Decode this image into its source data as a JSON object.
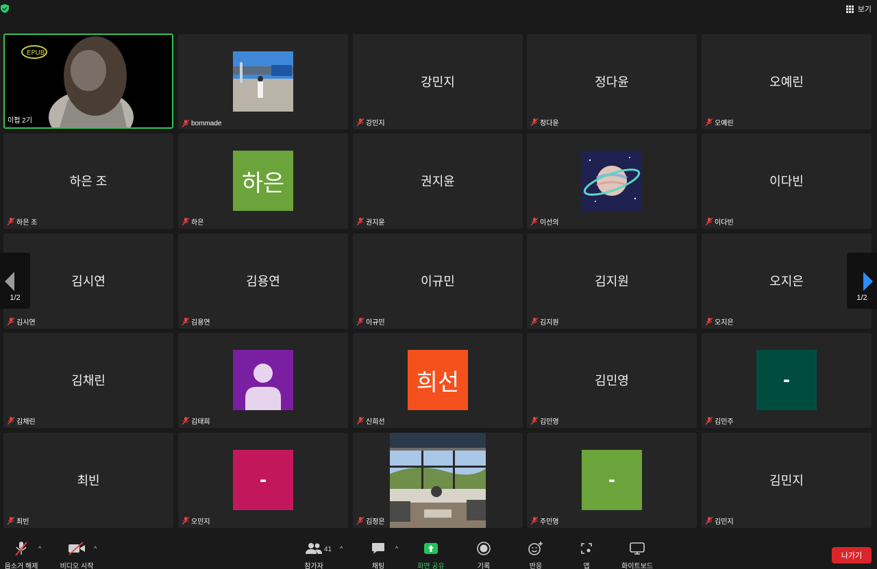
{
  "topbar": {
    "view_label": "보기"
  },
  "pager": {
    "left_page": "1/2",
    "right_page": "1/2"
  },
  "tiles": [
    {
      "footer": "이펍 2기",
      "center": "",
      "avatar": ""
    },
    {
      "footer": "bommade",
      "center": "",
      "avatar": ""
    },
    {
      "footer": "강민지",
      "center": "강민지",
      "avatar": ""
    },
    {
      "footer": "정다윤",
      "center": "정다윤",
      "avatar": ""
    },
    {
      "footer": "오예린",
      "center": "오예린",
      "avatar": ""
    },
    {
      "footer": "하은 조",
      "center": "하은 조",
      "avatar": ""
    },
    {
      "footer": "하은",
      "center": "",
      "avatar": "하은"
    },
    {
      "footer": "권지윤",
      "center": "권지윤",
      "avatar": ""
    },
    {
      "footer": "이선의",
      "center": "",
      "avatar": ""
    },
    {
      "footer": "이다빈",
      "center": "이다빈",
      "avatar": ""
    },
    {
      "footer": "김시연",
      "center": "김시연",
      "avatar": ""
    },
    {
      "footer": "김용연",
      "center": "김용연",
      "avatar": ""
    },
    {
      "footer": "이규민",
      "center": "이규민",
      "avatar": ""
    },
    {
      "footer": "김지원",
      "center": "김지원",
      "avatar": ""
    },
    {
      "footer": "오지은",
      "center": "오지은",
      "avatar": ""
    },
    {
      "footer": "김채린",
      "center": "김채린",
      "avatar": ""
    },
    {
      "footer": "김태희",
      "center": "",
      "avatar": ""
    },
    {
      "footer": "신희선",
      "center": "",
      "avatar": "희선"
    },
    {
      "footer": "김민영",
      "center": "김민영",
      "avatar": ""
    },
    {
      "footer": "김민주",
      "center": "",
      "avatar": "-"
    },
    {
      "footer": "최빈",
      "center": "최빈",
      "avatar": ""
    },
    {
      "footer": "오민지",
      "center": "",
      "avatar": "-"
    },
    {
      "footer": "김정은",
      "center": "",
      "avatar": ""
    },
    {
      "footer": "주민영",
      "center": "",
      "avatar": "-"
    },
    {
      "footer": "김민지",
      "center": "김민지",
      "avatar": ""
    }
  ],
  "colors": {
    "avatar_green": "#6aa43a",
    "avatar_orange": "#f4511e",
    "avatar_purple": "#7b1fa2",
    "avatar_teal": "#004d40",
    "avatar_magenta": "#c2185b",
    "active_border": "#32c45a",
    "leave_red": "#d9262b",
    "share_green": "#3ec66b"
  },
  "toolbar": {
    "unmute": "음소거 해제",
    "start_video": "비디오 시작",
    "participants": "참가자",
    "participants_count": "41",
    "chat": "채팅",
    "share_screen": "화면 공유",
    "record": "기록",
    "reactions": "반응",
    "apps": "앱",
    "whiteboard": "화이트보드",
    "leave": "나가기"
  }
}
